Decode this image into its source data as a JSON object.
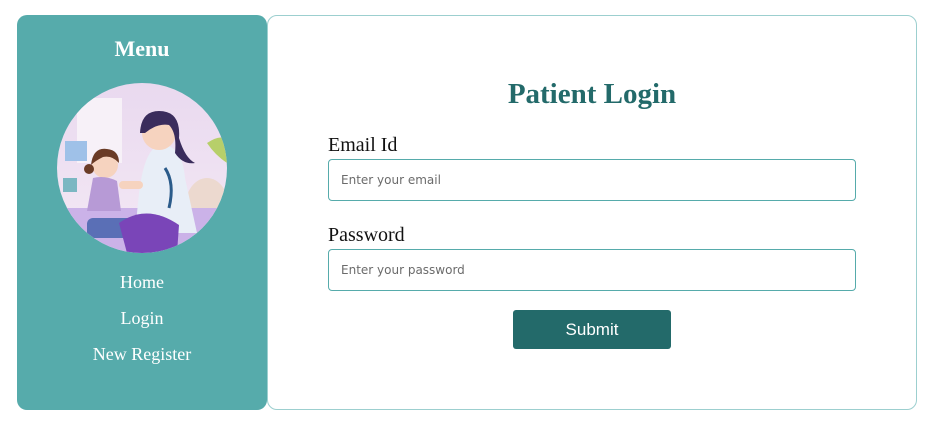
{
  "sidebar": {
    "title": "Menu",
    "image_icon": "nurse-with-child-illustration",
    "nav": [
      {
        "label": "Home"
      },
      {
        "label": "Login"
      },
      {
        "label": "New Register"
      }
    ]
  },
  "form": {
    "title": "Patient Login",
    "email": {
      "label": "Email Id",
      "placeholder": "Enter your email",
      "value": ""
    },
    "password": {
      "label": "Password",
      "placeholder": "Enter your password",
      "value": ""
    },
    "submit_label": "Submit"
  },
  "colors": {
    "sidebar_bg": "#56abab",
    "accent_dark": "#236a6a",
    "panel_border": "#9ccfcf"
  }
}
